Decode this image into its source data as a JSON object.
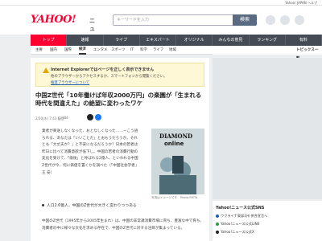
{
  "topbar": {
    "links": "Yahoo! JAPAN ヘルプ"
  },
  "header": {
    "logo": "YAHOO!",
    "logo_sub": "ニュース",
    "search_placeholder": "キーワードを入力",
    "search_button": "検索"
  },
  "nav": {
    "items": [
      {
        "label": "トップ",
        "active": true
      },
      {
        "label": "速報",
        "active": false
      },
      {
        "label": "ライブ",
        "active": false
      },
      {
        "label": "エキスパート",
        "active": false
      },
      {
        "label": "オリジナル",
        "active": false
      },
      {
        "label": "みんなの意見",
        "active": false
      },
      {
        "label": "ランキング",
        "active": false
      },
      {
        "label": "有料",
        "active": false
      }
    ]
  },
  "subnav": {
    "items": [
      "主要",
      "国内",
      "国際",
      "経済",
      "エンタメ",
      "スポーツ",
      "IT",
      "科学",
      "ライフ",
      "地域"
    ],
    "active": "経済",
    "right": "トピックス一覧"
  },
  "notice": {
    "title": "Internet Explorerではページを正しく表示できません",
    "line1": "他のブラウザーからアクセスするか、スマートフォンから閲覧ください。",
    "link": "推奨ブラウザーについて"
  },
  "article": {
    "title": "中国Z世代「10年働けば年収2000万円」の楽園が「生まれる時代を間違えた」の絶望に変わったワケ",
    "date": "2/20(木) 7:43 配信",
    "comments": "184",
    "body": "業者が楽送しなくなった、おとなしくなった……ーこう語られる、あなたは「いいことだ」とおもうだろうか。それとも「大丈夫か？」と不安になるだろうか？日本の若者は昨日に比べて消費意欲が低下し、中国の若者の消費行動の変化を受けて、「歳後」と呼ばれる2億人、といわれる中国Z世代が今、何に価値を置くかを調べた（「中国社会学者」王 安）",
    "photo_logo_1": "DIAMOND",
    "photo_logo_2": "online",
    "caption": "写真はイメージです　Photo:PIXTA",
    "bullet": "人口2.6億人、中国のZ世代が大きく変わりつつある",
    "body2": "中国のZ世代（1995年から2005年生まれ）は、中国の非常識消費市場に育ち、豊富な中で育ち、消費者の中に様々な文化を求める存在で、中国のZ世代に対する注目が集まっている。"
  },
  "sidebar": {
    "heading": "Yahoo!ニュース公式SNS",
    "rows": [
      {
        "label": "ウクライナ東部2州 併合宣言へ",
        "color": "#1a5fb4"
      },
      {
        "label": "Yahoo!ニュース公式LINE",
        "color": "#2b9c3b"
      },
      {
        "label": "Yahoo!ニュース公式X",
        "color": "#222222"
      }
    ]
  },
  "colors": {
    "brand": "#ff0033",
    "nav_bg": "#444b55",
    "notice_bg": "#fff8d6",
    "link": "#1a5fb4"
  }
}
